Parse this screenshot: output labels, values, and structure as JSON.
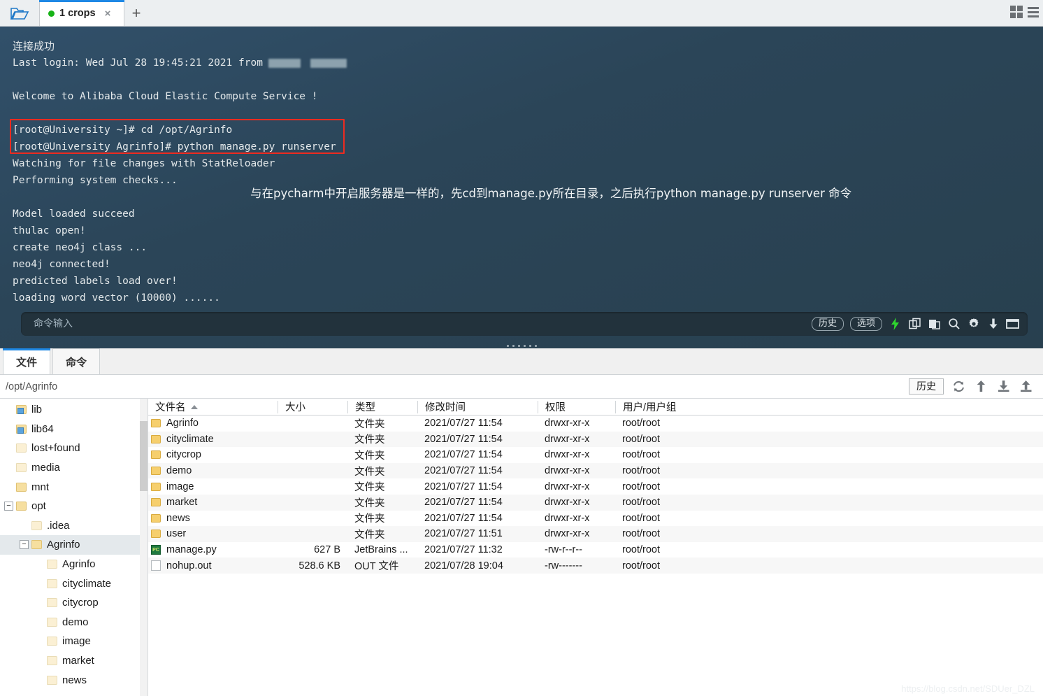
{
  "window": {
    "tab": {
      "title": "1 crops",
      "dot_color": "#17b317",
      "close_label": "×"
    },
    "new_tab_label": "+",
    "open_folder_name": "open-folder-icon",
    "grid_view_name": "grid-view-icon",
    "list_view_name": "list-view-icon"
  },
  "terminal": {
    "background": "#2c4758",
    "lines": [
      {
        "text": "连接成功",
        "cjk": true
      },
      {
        "text": "Last login: Wed Jul 28 19:45:21 2021 from",
        "redacted": true
      },
      {
        "text": ""
      },
      {
        "text": "Welcome to Alibaba Cloud Elastic Compute Service !"
      },
      {
        "text": ""
      },
      {
        "text": "[root@University ~]# cd /opt/Agrinfo"
      },
      {
        "text": "[root@University Agrinfo]# python manage.py runserver"
      },
      {
        "text": "Watching for file changes with StatReloader"
      },
      {
        "text": "Performing system checks..."
      },
      {
        "text": ""
      },
      {
        "text": "Model loaded succeed"
      },
      {
        "text": "thulac open!"
      },
      {
        "text": "create neo4j class ..."
      },
      {
        "text": "neo4j connected!"
      },
      {
        "text": "predicted labels load over!"
      },
      {
        "text": "loading word vector (10000) ......"
      }
    ],
    "highlight_color": "#ee2b20",
    "annotation": "与在pycharm中开启服务器是一样的，先cd到manage.py所在目录，之后执行python manage.py runserver 命令",
    "command_input": {
      "placeholder": "命令输入",
      "value": ""
    },
    "buttons": {
      "history": "历史",
      "options": "选项"
    },
    "tool_icons": [
      "lightning-icon",
      "copy-icon",
      "paste-icon",
      "search-icon",
      "gear-icon",
      "download-icon",
      "window-icon"
    ],
    "lightning_color": "#2ed62e"
  },
  "filebrowser": {
    "tabs": [
      {
        "label": "文件",
        "active": true
      },
      {
        "label": "命令",
        "active": false
      }
    ],
    "path": "/opt/Agrinfo",
    "history_button": "历史",
    "toolbar_icons": [
      "refresh-icon",
      "go-up-icon",
      "download-icon",
      "upload-icon"
    ],
    "tree": [
      {
        "label": "lib",
        "indent": 1,
        "expander": "",
        "icon": "folder-link"
      },
      {
        "label": "lib64",
        "indent": 1,
        "expander": "",
        "icon": "folder-link"
      },
      {
        "label": "lost+found",
        "indent": 1,
        "expander": "",
        "icon": "folder-pale"
      },
      {
        "label": "media",
        "indent": 1,
        "expander": "",
        "icon": "folder-pale"
      },
      {
        "label": "mnt",
        "indent": 1,
        "expander": "",
        "icon": "folder"
      },
      {
        "label": "opt",
        "indent": 1,
        "expander": "−",
        "icon": "folder"
      },
      {
        "label": ".idea",
        "indent": 2,
        "expander": "",
        "icon": "folder-pale"
      },
      {
        "label": "Agrinfo",
        "indent": 2,
        "expander": "−",
        "icon": "folder",
        "selected": true
      },
      {
        "label": "Agrinfo",
        "indent": 3,
        "expander": "",
        "icon": "folder-pale"
      },
      {
        "label": "cityclimate",
        "indent": 3,
        "expander": "",
        "icon": "folder-pale"
      },
      {
        "label": "citycrop",
        "indent": 3,
        "expander": "",
        "icon": "folder-pale"
      },
      {
        "label": "demo",
        "indent": 3,
        "expander": "",
        "icon": "folder-pale"
      },
      {
        "label": "image",
        "indent": 3,
        "expander": "",
        "icon": "folder-pale"
      },
      {
        "label": "market",
        "indent": 3,
        "expander": "",
        "icon": "folder-pale"
      },
      {
        "label": "news",
        "indent": 3,
        "expander": "",
        "icon": "folder-pale"
      }
    ],
    "columns": [
      {
        "key": "name",
        "label": "文件名",
        "sorted": true
      },
      {
        "key": "size",
        "label": "大小"
      },
      {
        "key": "type",
        "label": "类型"
      },
      {
        "key": "time",
        "label": "修改时间"
      },
      {
        "key": "perm",
        "label": "权限"
      },
      {
        "key": "user",
        "label": "用户/用户组"
      }
    ],
    "rows": [
      {
        "icon": "dir",
        "name": "Agrinfo",
        "size": "",
        "type": "文件夹",
        "time": "2021/07/27 11:54",
        "perm": "drwxr-xr-x",
        "user": "root/root"
      },
      {
        "icon": "dir",
        "name": "cityclimate",
        "size": "",
        "type": "文件夹",
        "time": "2021/07/27 11:54",
        "perm": "drwxr-xr-x",
        "user": "root/root"
      },
      {
        "icon": "dir",
        "name": "citycrop",
        "size": "",
        "type": "文件夹",
        "time": "2021/07/27 11:54",
        "perm": "drwxr-xr-x",
        "user": "root/root"
      },
      {
        "icon": "dir",
        "name": "demo",
        "size": "",
        "type": "文件夹",
        "time": "2021/07/27 11:54",
        "perm": "drwxr-xr-x",
        "user": "root/root"
      },
      {
        "icon": "dir",
        "name": "image",
        "size": "",
        "type": "文件夹",
        "time": "2021/07/27 11:54",
        "perm": "drwxr-xr-x",
        "user": "root/root"
      },
      {
        "icon": "dir",
        "name": "market",
        "size": "",
        "type": "文件夹",
        "time": "2021/07/27 11:54",
        "perm": "drwxr-xr-x",
        "user": "root/root"
      },
      {
        "icon": "dir",
        "name": "news",
        "size": "",
        "type": "文件夹",
        "time": "2021/07/27 11:54",
        "perm": "drwxr-xr-x",
        "user": "root/root"
      },
      {
        "icon": "dir",
        "name": "user",
        "size": "",
        "type": "文件夹",
        "time": "2021/07/27 11:51",
        "perm": "drwxr-xr-x",
        "user": "root/root"
      },
      {
        "icon": "py",
        "name": "manage.py",
        "size": "627 B",
        "type": "JetBrains ...",
        "time": "2021/07/27 11:32",
        "perm": "-rw-r--r--",
        "user": "root/root"
      },
      {
        "icon": "doc",
        "name": "nohup.out",
        "size": "528.6 KB",
        "type": "OUT 文件",
        "time": "2021/07/28 19:04",
        "perm": "-rw-------",
        "user": "root/root"
      }
    ]
  },
  "watermark": "https://blog.csdn.net/SDUer_DZL"
}
